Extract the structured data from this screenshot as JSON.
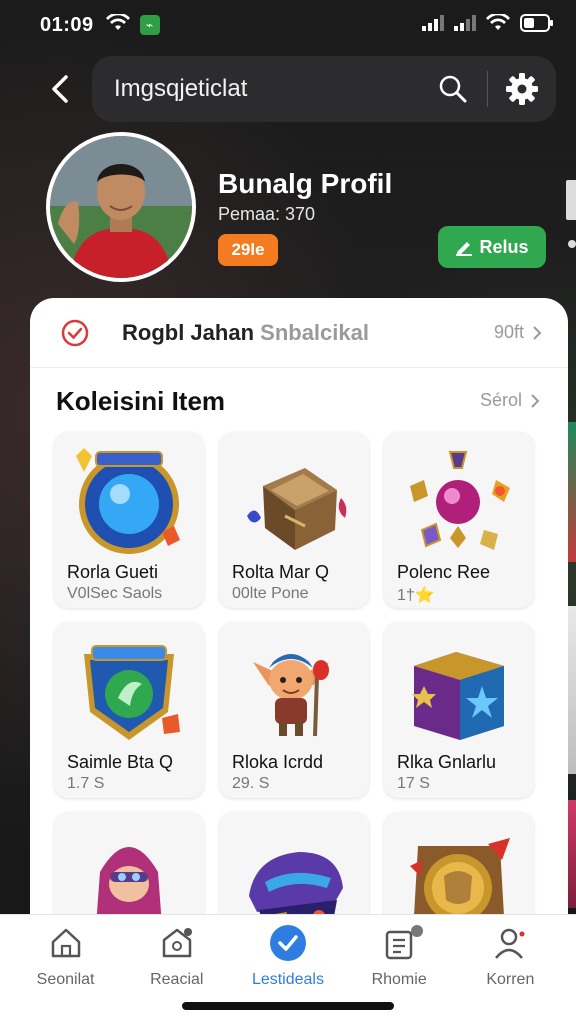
{
  "status_bar": {
    "time": "01:09",
    "app_badge": "⌁",
    "icons": [
      "wifi-icon",
      "app-notification-icon",
      "cellular-signal-icon",
      "cellular-signal-2-icon",
      "wifi-icon",
      "battery-icon"
    ]
  },
  "header": {
    "search_text": "Imgsqjeticlat",
    "icons": [
      "back-arrow-icon",
      "search-icon",
      "gear-icon"
    ]
  },
  "profile": {
    "name": "Bunalg Profil",
    "subtitle": "Pemaa: 370",
    "badge": "29le",
    "action_label": "Relus",
    "avatar_icon": "person-avatar"
  },
  "task": {
    "title_main": "Rogbl Jahan",
    "title_muted": "Snbalcikal",
    "more_label": "90ft"
  },
  "collection": {
    "title": "Koleisini Item",
    "more_label": "Sérol"
  },
  "items": [
    {
      "name": "Rorla Gueti",
      "sub": "V0lSec Saols",
      "icon": "blue-orb-shield-icon"
    },
    {
      "name": "Rolta Mar Q",
      "sub": "00lte Pone",
      "icon": "treasure-box-icon"
    },
    {
      "name": "Polenc Ree",
      "sub": "1†⭐",
      "icon": "magic-orb-gems-icon"
    },
    {
      "name": "Saimle Bta Q",
      "sub": "1.7 S",
      "icon": "green-emblem-shield-icon"
    },
    {
      "name": "Rloka Icrdd",
      "sub": "29. S",
      "icon": "goblin-warrior-icon"
    },
    {
      "name": "Rlka Gnlarlu",
      "sub": "17 S",
      "icon": "star-chest-icon"
    },
    {
      "name": "",
      "sub": "",
      "icon": "hooded-character-icon"
    },
    {
      "name": "",
      "sub": "",
      "icon": "purple-helmet-icon"
    },
    {
      "name": "",
      "sub": "",
      "icon": "golden-emblem-icon"
    }
  ],
  "bottom_nav": [
    {
      "label": "Seonilat",
      "icon": "home-icon",
      "active": false
    },
    {
      "label": "Reacial",
      "icon": "house-badge-icon",
      "active": false
    },
    {
      "label": "Lestideals",
      "icon": "check-badge-icon",
      "active": true
    },
    {
      "label": "Rhomie",
      "icon": "clipboard-icon",
      "active": false
    },
    {
      "label": "Korren",
      "icon": "profile-icon",
      "active": false
    }
  ],
  "colors": {
    "accent_orange": "#f47b20",
    "accent_green": "#2fa84f",
    "active_blue": "#2f7de1"
  }
}
